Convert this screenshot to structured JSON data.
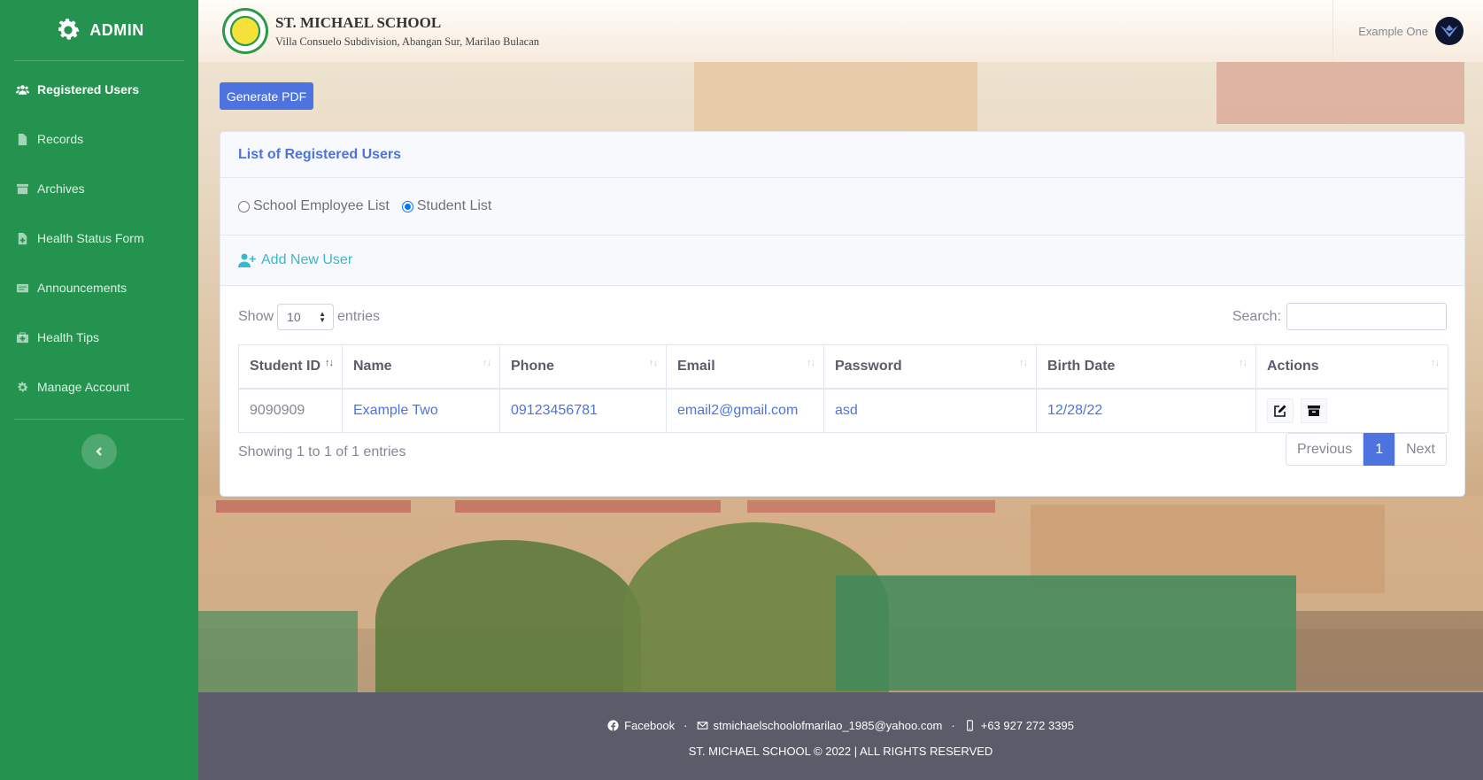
{
  "sidebar": {
    "brand": "ADMIN",
    "items": [
      {
        "label": "Registered Users",
        "icon": "users-icon",
        "active": true
      },
      {
        "label": "Records",
        "icon": "file-icon"
      },
      {
        "label": "Archives",
        "icon": "archive-icon"
      },
      {
        "label": "Health Status Form",
        "icon": "medical-file-icon"
      },
      {
        "label": "Announcements",
        "icon": "announcement-icon"
      },
      {
        "label": "Health Tips",
        "icon": "first-aid-icon"
      },
      {
        "label": "Manage Account",
        "icon": "gear-icon"
      }
    ]
  },
  "header": {
    "school_name": "ST. MICHAEL SCHOOL",
    "school_address": "Villa Consuelo Subdivision, Abangan Sur, Marilao Bulacan",
    "user_name": "Example One"
  },
  "toolbar": {
    "generate_pdf": "Generate PDF"
  },
  "card": {
    "title": "List of Registered Users",
    "filters": [
      {
        "label": "School Employee List",
        "checked": false
      },
      {
        "label": "Student List",
        "checked": true
      }
    ],
    "add_user": "Add New User"
  },
  "table_controls": {
    "show_label": "Show",
    "entries_value": "10",
    "entries_label": "entries",
    "search_label": "Search:"
  },
  "table": {
    "columns": [
      "Student ID",
      "Name",
      "Phone",
      "Email",
      "Password",
      "Birth Date",
      "Actions"
    ],
    "rows": [
      {
        "student_id": "9090909",
        "name": "Example Two",
        "phone": "09123456781",
        "email": "email2@gmail.com",
        "password": "asd",
        "birth_date": "12/28/22"
      }
    ]
  },
  "pagination": {
    "info": "Showing 1 to 1 of 1 entries",
    "previous": "Previous",
    "current": "1",
    "next": "Next"
  },
  "footer": {
    "facebook": "Facebook",
    "email": "stmichaelschoolofmarilao_1985@yahoo.com",
    "phone": "+63 927 272 3395",
    "dot": "·",
    "copyright": "ST. MICHAEL SCHOOL © 2022 | ALL RIGHTS RESERVED"
  },
  "colors": {
    "sidebar": "#23934f",
    "primary": "#4e73df",
    "info": "#36b9cc",
    "footer": "#5a5c69"
  }
}
